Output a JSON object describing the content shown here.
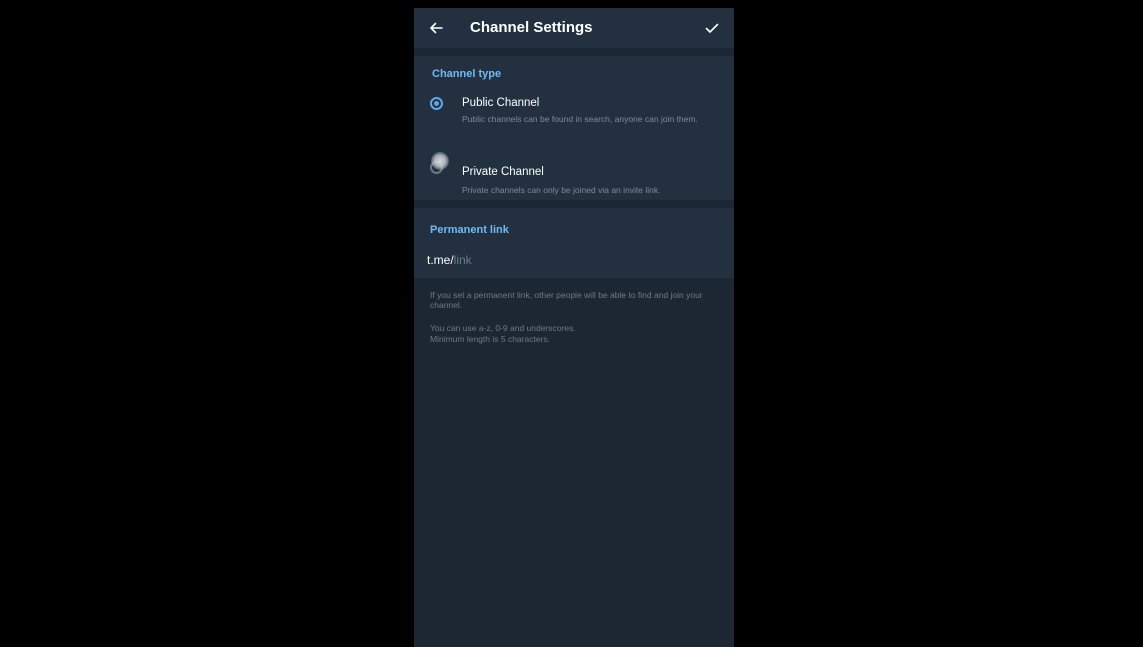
{
  "header": {
    "title": "Channel Settings",
    "back_icon": "arrow-left-icon",
    "confirm_icon": "checkmark-icon"
  },
  "channel_type": {
    "section_title": "Channel type",
    "options": [
      {
        "label": "Public Channel",
        "description": "Public channels can be found in search, anyone can join them.",
        "selected": true
      },
      {
        "label": "Private Channel",
        "description": "Private channels can only be joined via an invite link.",
        "selected": false
      }
    ]
  },
  "permanent_link": {
    "section_title": "Permanent link",
    "prefix": "t.me/",
    "value": "",
    "placeholder": "link"
  },
  "help": {
    "line1": "If you set a permanent link, other people will be able to find and join your channel.",
    "line2": "You can use a-z, 0-9 and underscores.",
    "line3": "Minimum length is 5 characters."
  },
  "colors": {
    "background": "#1c2733",
    "panel": "#233040",
    "accent": "#5fa8e8",
    "section_header": "#71baf5",
    "secondary_text": "#7d8b99"
  }
}
